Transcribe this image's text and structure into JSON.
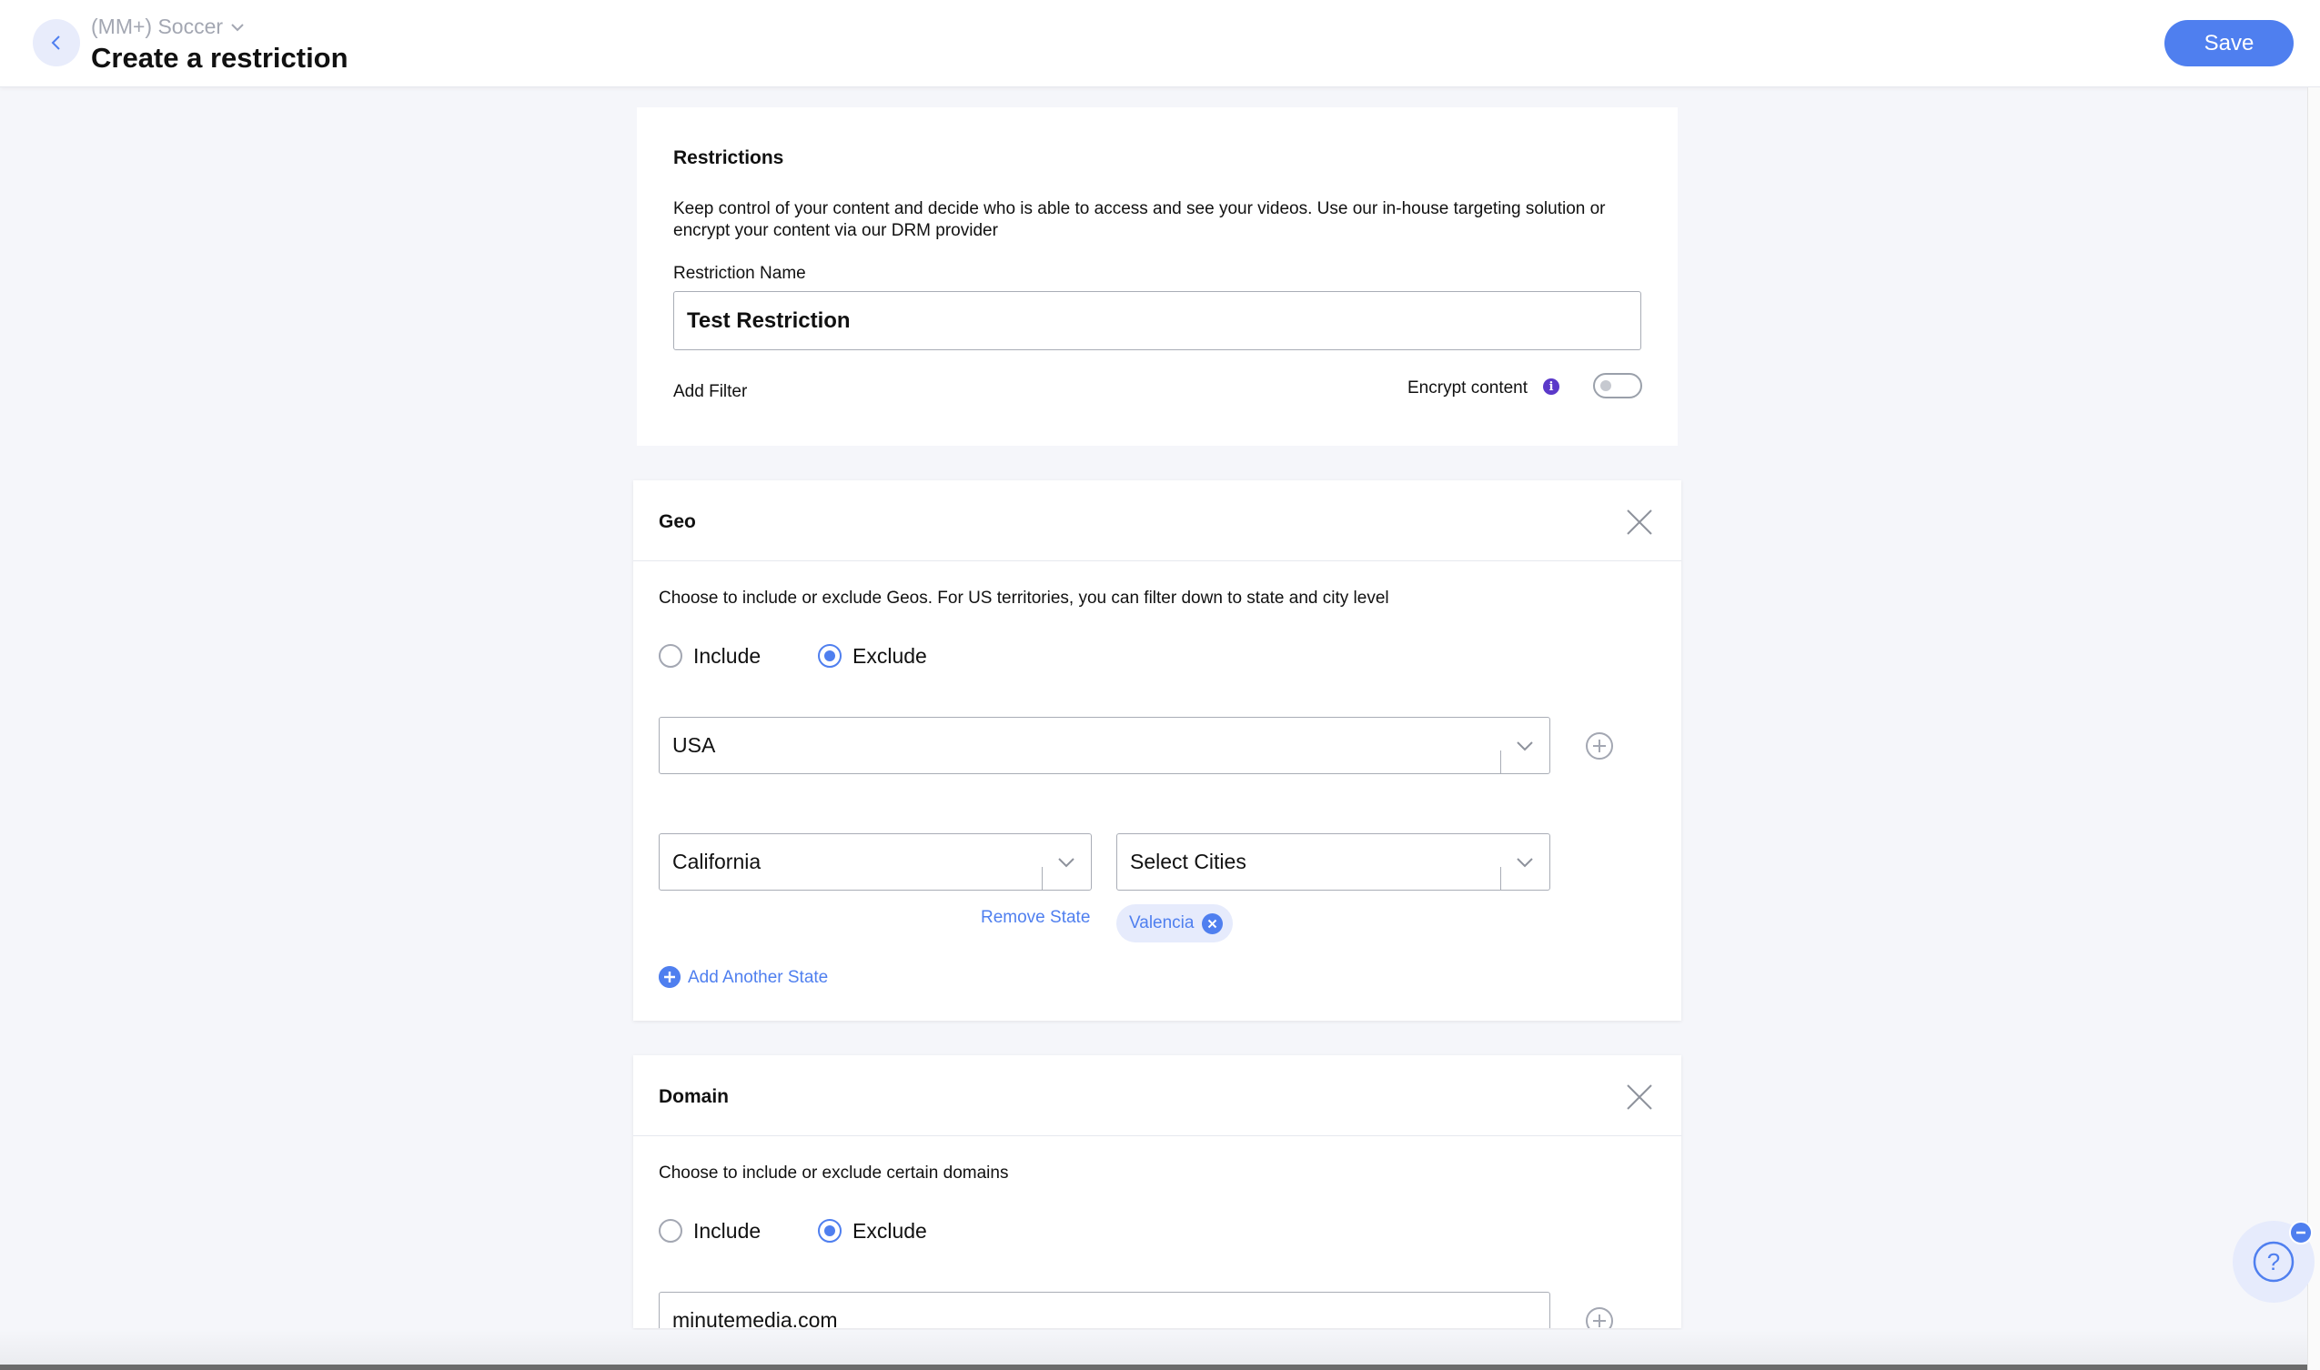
{
  "header": {
    "breadcrumb": "(MM+) Soccer",
    "title": "Create a restriction",
    "save_label": "Save"
  },
  "restrictions": {
    "title": "Restrictions",
    "description_line1": "Keep control of your content and decide who is able to access and see your videos. Use our in-house targeting solution or",
    "description_line2": "encrypt your content via our DRM provider",
    "name_label": "Restriction Name",
    "name_value": "Test Restriction",
    "add_filter_label": "Add Filter",
    "encrypt_label": "Encrypt content",
    "encrypt_info_glyph": "i",
    "encrypt_enabled": false
  },
  "geo": {
    "title": "Geo",
    "description": "Choose to include or exclude Geos. For US territories, you can filter down to state and city level",
    "include_label": "Include",
    "exclude_label": "Exclude",
    "selected_mode": "exclude",
    "country_value": "USA",
    "state_value": "California",
    "cities_placeholder": "Select Cities",
    "remove_state_label": "Remove State",
    "city_chips": [
      "Valencia"
    ],
    "add_state_label": "Add Another State"
  },
  "domain": {
    "title": "Domain",
    "description": "Choose to include or exclude certain domains",
    "include_label": "Include",
    "exclude_label": "Exclude",
    "selected_mode": "exclude",
    "domain_value": "minutemedia.com"
  },
  "help": {
    "glyph": "?"
  },
  "colors": {
    "accent": "#4f7fef",
    "info": "#5b39c9",
    "background": "#f5f6fa"
  }
}
